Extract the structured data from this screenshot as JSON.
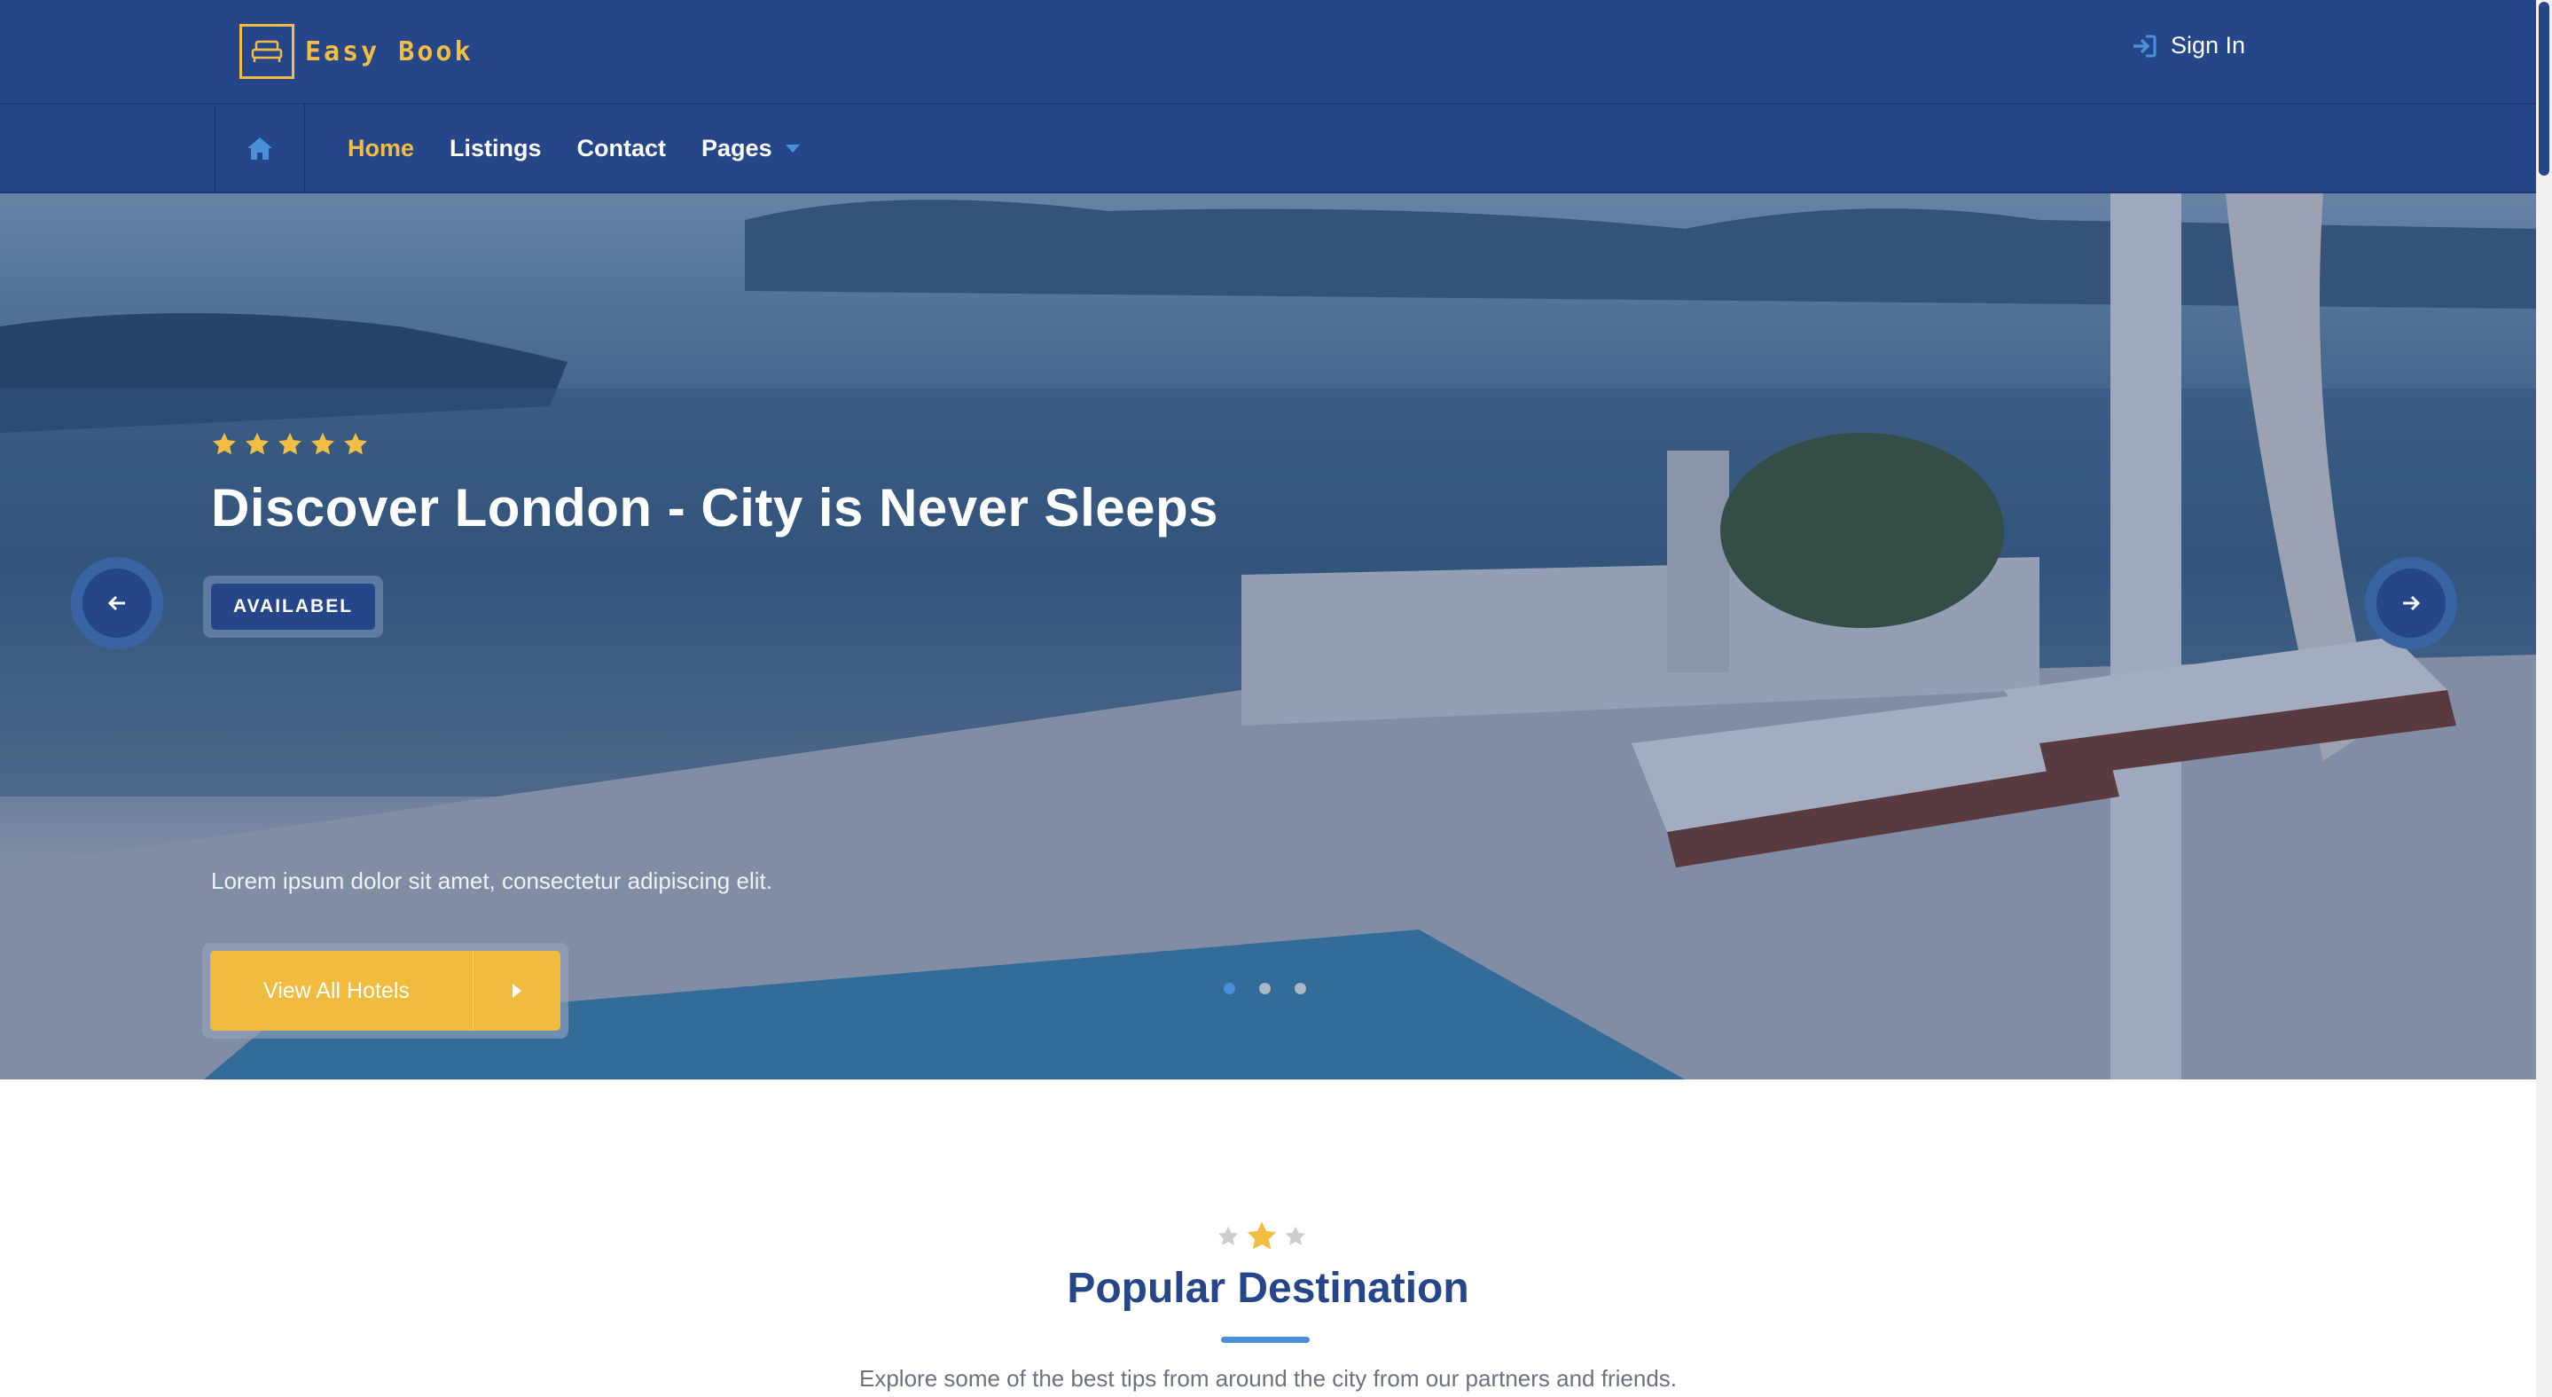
{
  "brand": {
    "name": "Easy Book",
    "logo_icon": "bed-icon",
    "accent_color": "#f2bd42",
    "primary_color": "#26468a"
  },
  "header": {
    "signin_label": "Sign In",
    "signin_icon": "sign-in-icon"
  },
  "nav": {
    "home_icon": "home-icon",
    "items": [
      {
        "label": "Home",
        "active": true
      },
      {
        "label": "Listings"
      },
      {
        "label": "Contact"
      },
      {
        "label": "Pages",
        "has_dropdown": true
      }
    ]
  },
  "hero": {
    "rating_stars": 5,
    "title": "Discover London - City is Never Sleeps",
    "badge": "AVAILABEL",
    "description": "Lorem ipsum dolor sit amet, consectetur adipiscing elit.",
    "cta_label": "View All Hotels",
    "slide_count": 3,
    "active_slide": 1
  },
  "section": {
    "title": "Popular Destination",
    "subtitle": "Explore some of the best tips from around the city from our partners and friends."
  }
}
